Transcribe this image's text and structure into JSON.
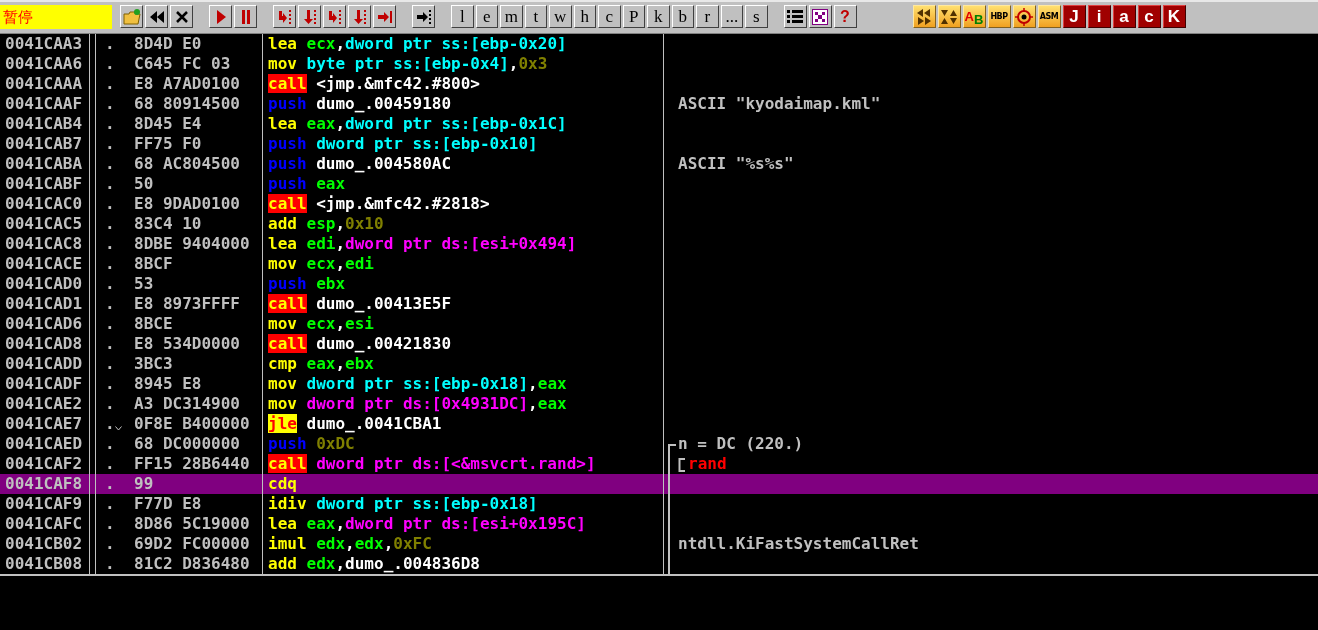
{
  "toolbar": {
    "status": "暂停",
    "letter_buttons": [
      "l",
      "e",
      "m",
      "t",
      "w",
      "h",
      "c",
      "P",
      "k",
      "b",
      "r",
      "...",
      "s"
    ],
    "help_button": "?",
    "ab_button": {
      "first": "A",
      "second": "B"
    },
    "hbp_button": "HBP",
    "asm_button": "ASM",
    "plugin_letters": [
      "J",
      "i",
      "a",
      "c",
      "K"
    ]
  },
  "rows": [
    {
      "address": "0041CAA3",
      "mark": ".",
      "jump": false,
      "hex": "8D4D E0",
      "selected": false,
      "bracket_start": false,
      "in_bracket": false,
      "asm": [
        {
          "text": "lea",
          "kind": "mnemonic"
        },
        {
          "text": "ecx",
          "kind": "register"
        },
        {
          "text": ",",
          "kind": "plain"
        },
        {
          "text": "dword ptr ss:[ebp-0x20]",
          "kind": "stack"
        }
      ]
    },
    {
      "address": "0041CAA6",
      "mark": ".",
      "jump": false,
      "hex": "C645 FC 03",
      "selected": false,
      "bracket_start": false,
      "in_bracket": false,
      "asm": [
        {
          "text": "mov",
          "kind": "mnemonic"
        },
        {
          "text": "byte ptr ss:[ebp-0x4]",
          "kind": "stack"
        },
        {
          "text": ",",
          "kind": "plain"
        },
        {
          "text": "0x3",
          "kind": "constant"
        }
      ]
    },
    {
      "address": "0041CAAA",
      "mark": ".",
      "jump": false,
      "hex": "E8 A7AD0100",
      "selected": false,
      "bracket_start": false,
      "in_bracket": false,
      "asm": [
        {
          "text": "call",
          "kind": "call"
        },
        {
          "text": "<jmp.&mfc42.#800>",
          "kind": "plain"
        }
      ]
    },
    {
      "address": "0041CAAF",
      "mark": ".",
      "jump": false,
      "hex": "68 80914500",
      "selected": false,
      "bracket_start": false,
      "in_bracket": false,
      "asm": [
        {
          "text": "push",
          "kind": "push"
        },
        {
          "text": "dumo_.00459180",
          "kind": "plain"
        }
      ],
      "comment": {
        "text": "ASCII \"kyodaimap.kml\"",
        "kind": "plain"
      }
    },
    {
      "address": "0041CAB4",
      "mark": ".",
      "jump": false,
      "hex": "8D45 E4",
      "selected": false,
      "bracket_start": false,
      "in_bracket": false,
      "asm": [
        {
          "text": "lea",
          "kind": "mnemonic"
        },
        {
          "text": "eax",
          "kind": "register"
        },
        {
          "text": ",",
          "kind": "plain"
        },
        {
          "text": "dword ptr ss:[ebp-0x1C]",
          "kind": "stack"
        }
      ]
    },
    {
      "address": "0041CAB7",
      "mark": ".",
      "jump": false,
      "hex": "FF75 F0",
      "selected": false,
      "bracket_start": false,
      "in_bracket": false,
      "asm": [
        {
          "text": "push",
          "kind": "push"
        },
        {
          "text": "dword ptr ss:[ebp-0x10]",
          "kind": "stack"
        }
      ]
    },
    {
      "address": "0041CABA",
      "mark": ".",
      "jump": false,
      "hex": "68 AC804500",
      "selected": false,
      "bracket_start": false,
      "in_bracket": false,
      "asm": [
        {
          "text": "push",
          "kind": "push"
        },
        {
          "text": "dumo_.004580AC",
          "kind": "plain"
        }
      ],
      "comment": {
        "text": "ASCII \"%s%s\"",
        "kind": "plain"
      }
    },
    {
      "address": "0041CABF",
      "mark": ".",
      "jump": false,
      "hex": "50",
      "selected": false,
      "bracket_start": false,
      "in_bracket": false,
      "asm": [
        {
          "text": "push",
          "kind": "push"
        },
        {
          "text": "eax",
          "kind": "register"
        }
      ]
    },
    {
      "address": "0041CAC0",
      "mark": ".",
      "jump": false,
      "hex": "E8 9DAD0100",
      "selected": false,
      "bracket_start": false,
      "in_bracket": false,
      "asm": [
        {
          "text": "call",
          "kind": "call"
        },
        {
          "text": "<jmp.&mfc42.#2818>",
          "kind": "plain"
        }
      ]
    },
    {
      "address": "0041CAC5",
      "mark": ".",
      "jump": false,
      "hex": "83C4 10",
      "selected": false,
      "bracket_start": false,
      "in_bracket": false,
      "asm": [
        {
          "text": "add",
          "kind": "mnemonic"
        },
        {
          "text": "esp",
          "kind": "register"
        },
        {
          "text": ",",
          "kind": "plain"
        },
        {
          "text": "0x10",
          "kind": "constant"
        }
      ]
    },
    {
      "address": "0041CAC8",
      "mark": ".",
      "jump": false,
      "hex": "8DBE 9404000",
      "selected": false,
      "bracket_start": false,
      "in_bracket": false,
      "asm": [
        {
          "text": "lea",
          "kind": "mnemonic"
        },
        {
          "text": "edi",
          "kind": "register"
        },
        {
          "text": ",",
          "kind": "plain"
        },
        {
          "text": "dword ptr ds:[esi+0x494]",
          "kind": "memory"
        }
      ]
    },
    {
      "address": "0041CACE",
      "mark": ".",
      "jump": false,
      "hex": "8BCF",
      "selected": false,
      "bracket_start": false,
      "in_bracket": false,
      "asm": [
        {
          "text": "mov",
          "kind": "mnemonic"
        },
        {
          "text": "ecx",
          "kind": "register"
        },
        {
          "text": ",",
          "kind": "plain"
        },
        {
          "text": "edi",
          "kind": "register"
        }
      ]
    },
    {
      "address": "0041CAD0",
      "mark": ".",
      "jump": false,
      "hex": "53",
      "selected": false,
      "bracket_start": false,
      "in_bracket": false,
      "asm": [
        {
          "text": "push",
          "kind": "push"
        },
        {
          "text": "ebx",
          "kind": "register"
        }
      ]
    },
    {
      "address": "0041CAD1",
      "mark": ".",
      "jump": false,
      "hex": "E8 8973FFFF",
      "selected": false,
      "bracket_start": false,
      "in_bracket": false,
      "asm": [
        {
          "text": "call",
          "kind": "call"
        },
        {
          "text": "dumo_.00413E5F",
          "kind": "plain"
        }
      ]
    },
    {
      "address": "0041CAD6",
      "mark": ".",
      "jump": false,
      "hex": "8BCE",
      "selected": false,
      "bracket_start": false,
      "in_bracket": false,
      "asm": [
        {
          "text": "mov",
          "kind": "mnemonic"
        },
        {
          "text": "ecx",
          "kind": "register"
        },
        {
          "text": ",",
          "kind": "plain"
        },
        {
          "text": "esi",
          "kind": "register"
        }
      ]
    },
    {
      "address": "0041CAD8",
      "mark": ".",
      "jump": false,
      "hex": "E8 534D0000",
      "selected": false,
      "bracket_start": false,
      "in_bracket": false,
      "asm": [
        {
          "text": "call",
          "kind": "call"
        },
        {
          "text": "dumo_.00421830",
          "kind": "plain"
        }
      ]
    },
    {
      "address": "0041CADD",
      "mark": ".",
      "jump": false,
      "hex": "3BC3",
      "selected": false,
      "bracket_start": false,
      "in_bracket": false,
      "asm": [
        {
          "text": "cmp",
          "kind": "mnemonic"
        },
        {
          "text": "eax",
          "kind": "register"
        },
        {
          "text": ",",
          "kind": "plain"
        },
        {
          "text": "ebx",
          "kind": "register"
        }
      ]
    },
    {
      "address": "0041CADF",
      "mark": ".",
      "jump": false,
      "hex": "8945 E8",
      "selected": false,
      "bracket_start": false,
      "in_bracket": false,
      "asm": [
        {
          "text": "mov",
          "kind": "mnemonic"
        },
        {
          "text": "dword ptr ss:[ebp-0x18]",
          "kind": "stack"
        },
        {
          "text": ",",
          "kind": "plain"
        },
        {
          "text": "eax",
          "kind": "register"
        }
      ]
    },
    {
      "address": "0041CAE2",
      "mark": ".",
      "jump": false,
      "hex": "A3 DC314900",
      "selected": false,
      "bracket_start": false,
      "in_bracket": false,
      "asm": [
        {
          "text": "mov",
          "kind": "mnemonic"
        },
        {
          "text": "dword ptr ds:[0x4931DC]",
          "kind": "memory"
        },
        {
          "text": ",",
          "kind": "plain"
        },
        {
          "text": "eax",
          "kind": "register"
        }
      ]
    },
    {
      "address": "0041CAE7",
      "mark": ".",
      "jump": true,
      "hex": "0F8E B400000",
      "selected": false,
      "bracket_start": false,
      "in_bracket": false,
      "asm": [
        {
          "text": "jle",
          "kind": "jump"
        },
        {
          "text": "dumo_.0041CBA1",
          "kind": "plain"
        }
      ]
    },
    {
      "address": "0041CAED",
      "mark": ".",
      "jump": false,
      "hex": "68 DC000000",
      "selected": false,
      "bracket_start": true,
      "in_bracket": false,
      "asm": [
        {
          "text": "push",
          "kind": "push"
        },
        {
          "text": "0xDC",
          "kind": "constant"
        }
      ],
      "comment": {
        "text": "n = DC (220.)",
        "kind": "plain"
      }
    },
    {
      "address": "0041CAF2",
      "mark": ".",
      "jump": false,
      "hex": "FF15 28B6440",
      "selected": false,
      "bracket_start": false,
      "in_bracket": true,
      "asm": [
        {
          "text": "call",
          "kind": "call"
        },
        {
          "text": "dword ptr ds:[<&msvcrt.rand>]",
          "kind": "memory"
        }
      ],
      "comment": {
        "text": "rand",
        "kind": "call"
      }
    },
    {
      "address": "0041CAF8",
      "mark": ".",
      "jump": false,
      "hex": "99",
      "selected": true,
      "bracket_start": false,
      "in_bracket": true,
      "asm": [
        {
          "text": "cdq",
          "kind": "mnemonic"
        }
      ]
    },
    {
      "address": "0041CAF9",
      "mark": ".",
      "jump": false,
      "hex": "F77D E8",
      "selected": false,
      "bracket_start": false,
      "in_bracket": true,
      "asm": [
        {
          "text": "idiv",
          "kind": "mnemonic"
        },
        {
          "text": "dword ptr ss:[ebp-0x18]",
          "kind": "stack"
        }
      ]
    },
    {
      "address": "0041CAFC",
      "mark": ".",
      "jump": false,
      "hex": "8D86 5C19000",
      "selected": false,
      "bracket_start": false,
      "in_bracket": true,
      "asm": [
        {
          "text": "lea",
          "kind": "mnemonic"
        },
        {
          "text": "eax",
          "kind": "register"
        },
        {
          "text": ",",
          "kind": "plain"
        },
        {
          "text": "dword ptr ds:[esi+0x195C]",
          "kind": "memory"
        }
      ]
    },
    {
      "address": "0041CB02",
      "mark": ".",
      "jump": false,
      "hex": "69D2 FC00000",
      "selected": false,
      "bracket_start": false,
      "in_bracket": true,
      "asm": [
        {
          "text": "imul",
          "kind": "mnemonic"
        },
        {
          "text": "edx",
          "kind": "register"
        },
        {
          "text": ",",
          "kind": "plain"
        },
        {
          "text": "edx",
          "kind": "register"
        },
        {
          "text": ",",
          "kind": "plain"
        },
        {
          "text": "0xFC",
          "kind": "constant"
        }
      ],
      "comment": {
        "text": "ntdll.KiFastSystemCallRet",
        "kind": "plain"
      }
    },
    {
      "address": "0041CB08",
      "mark": ".",
      "jump": false,
      "hex": "81C2 D836480",
      "selected": false,
      "bracket_start": false,
      "in_bracket": true,
      "asm": [
        {
          "text": "add",
          "kind": "mnemonic"
        },
        {
          "text": "edx",
          "kind": "register"
        },
        {
          "text": ",",
          "kind": "plain"
        },
        {
          "text": "dumo_.004836D8",
          "kind": "plain"
        }
      ]
    }
  ]
}
